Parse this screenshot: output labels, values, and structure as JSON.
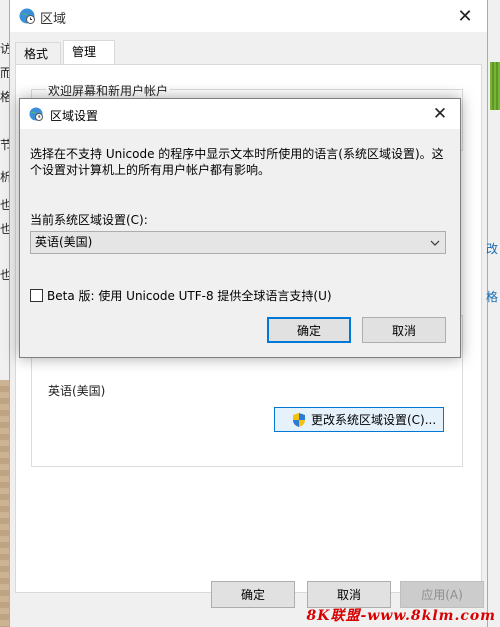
{
  "outer_window": {
    "title": "区域",
    "close_glyph": "✕",
    "tabs": [
      {
        "label": "格式"
      },
      {
        "label": "管理"
      }
    ],
    "welcome_group_label": "欢迎屏幕和新用户帐户",
    "nonunicode_group_text": "英语(美国)",
    "change_locale_button": "更改系统区域设置(C)...",
    "buttons": {
      "ok": "确定",
      "cancel": "取消",
      "apply": "应用(A)"
    }
  },
  "dialog": {
    "title": "区域设置",
    "close_glyph": "✕",
    "description": "选择在不支持 Unicode 的程序中显示文本时所使用的语言(系统区域设置)。这个设置对计算机上的所有用户帐户都有影响。",
    "locale_label": "当前系统区域设置(C):",
    "locale_value": "英语(美国)",
    "beta_checkbox_label": "Beta 版: 使用 Unicode UTF-8 提供全球语言支持(U)",
    "beta_checked": false,
    "buttons": {
      "ok": "确定",
      "cancel": "取消"
    }
  },
  "background_fragments": {
    "left": [
      "访",
      "而",
      "格",
      "节",
      "析",
      "也",
      "也",
      "也"
    ],
    "right": [
      "改",
      "格"
    ]
  },
  "watermark": "8K联盟-www.8klm.com",
  "colors": {
    "accent": "#0078d7",
    "dialog_bg": "#f0f0f0",
    "watermark": "#d80000"
  },
  "icons": {
    "window": "globe-clock-icon",
    "shield": "uac-shield-icon",
    "dropdown": "chevron-down-icon"
  }
}
